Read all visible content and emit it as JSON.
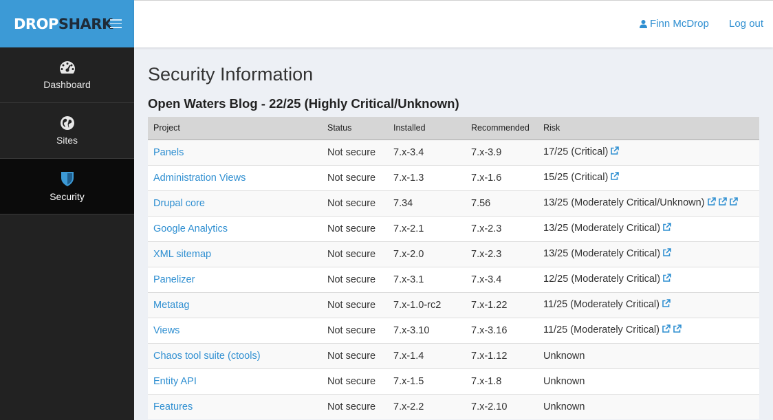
{
  "brand": {
    "part1": "DROP",
    "part2": "SHARK"
  },
  "nav": [
    {
      "label": "Dashboard",
      "icon": "dashboard-gauge-icon"
    },
    {
      "label": "Sites",
      "icon": "globe-icon"
    },
    {
      "label": "Security",
      "icon": "shield-icon",
      "active": true
    }
  ],
  "header": {
    "user_name": "Finn McDrop",
    "logout_label": "Log out"
  },
  "page": {
    "title": "Security Information",
    "site_heading": "Open Waters Blog - 22/25 (Highly Critical/Unknown)"
  },
  "table": {
    "columns": [
      "Project",
      "Status",
      "Installed",
      "Recommended",
      "Risk"
    ],
    "rows": [
      {
        "project": "Panels",
        "status": "Not secure",
        "installed": "7.x-3.4",
        "recommended": "7.x-3.9",
        "risk": "17/25 (Critical)",
        "links": 1
      },
      {
        "project": "Administration Views",
        "status": "Not secure",
        "installed": "7.x-1.3",
        "recommended": "7.x-1.6",
        "risk": "15/25 (Critical)",
        "links": 1
      },
      {
        "project": "Drupal core",
        "status": "Not secure",
        "installed": "7.34",
        "recommended": "7.56",
        "risk": "13/25 (Moderately Critical/Unknown)",
        "links": 3
      },
      {
        "project": "Google Analytics",
        "status": "Not secure",
        "installed": "7.x-2.1",
        "recommended": "7.x-2.3",
        "risk": "13/25 (Moderately Critical)",
        "links": 1
      },
      {
        "project": "XML sitemap",
        "status": "Not secure",
        "installed": "7.x-2.0",
        "recommended": "7.x-2.3",
        "risk": "13/25 (Moderately Critical)",
        "links": 1
      },
      {
        "project": "Panelizer",
        "status": "Not secure",
        "installed": "7.x-3.1",
        "recommended": "7.x-3.4",
        "risk": "12/25 (Moderately Critical)",
        "links": 1
      },
      {
        "project": "Metatag",
        "status": "Not secure",
        "installed": "7.x-1.0-rc2",
        "recommended": "7.x-1.22",
        "risk": "11/25 (Moderately Critical)",
        "links": 1
      },
      {
        "project": "Views",
        "status": "Not secure",
        "installed": "7.x-3.10",
        "recommended": "7.x-3.16",
        "risk": "11/25 (Moderately Critical)",
        "links": 2
      },
      {
        "project": "Chaos tool suite (ctools)",
        "status": "Not secure",
        "installed": "7.x-1.4",
        "recommended": "7.x-1.12",
        "risk": "Unknown",
        "links": 0
      },
      {
        "project": "Entity API",
        "status": "Not secure",
        "installed": "7.x-1.5",
        "recommended": "7.x-1.8",
        "risk": "Unknown",
        "links": 0
      },
      {
        "project": "Features",
        "status": "Not secure",
        "installed": "7.x-2.2",
        "recommended": "7.x-2.10",
        "risk": "Unknown",
        "links": 0
      }
    ]
  },
  "colors": {
    "accent": "#3c9ad6",
    "link": "#2f8fd1",
    "sidebar": "#222222",
    "sidebar_active": "#0b0b0b"
  },
  "icons": {
    "external_link": "external-link-icon",
    "user": "user-icon",
    "menu": "hamburger-menu-icon"
  }
}
